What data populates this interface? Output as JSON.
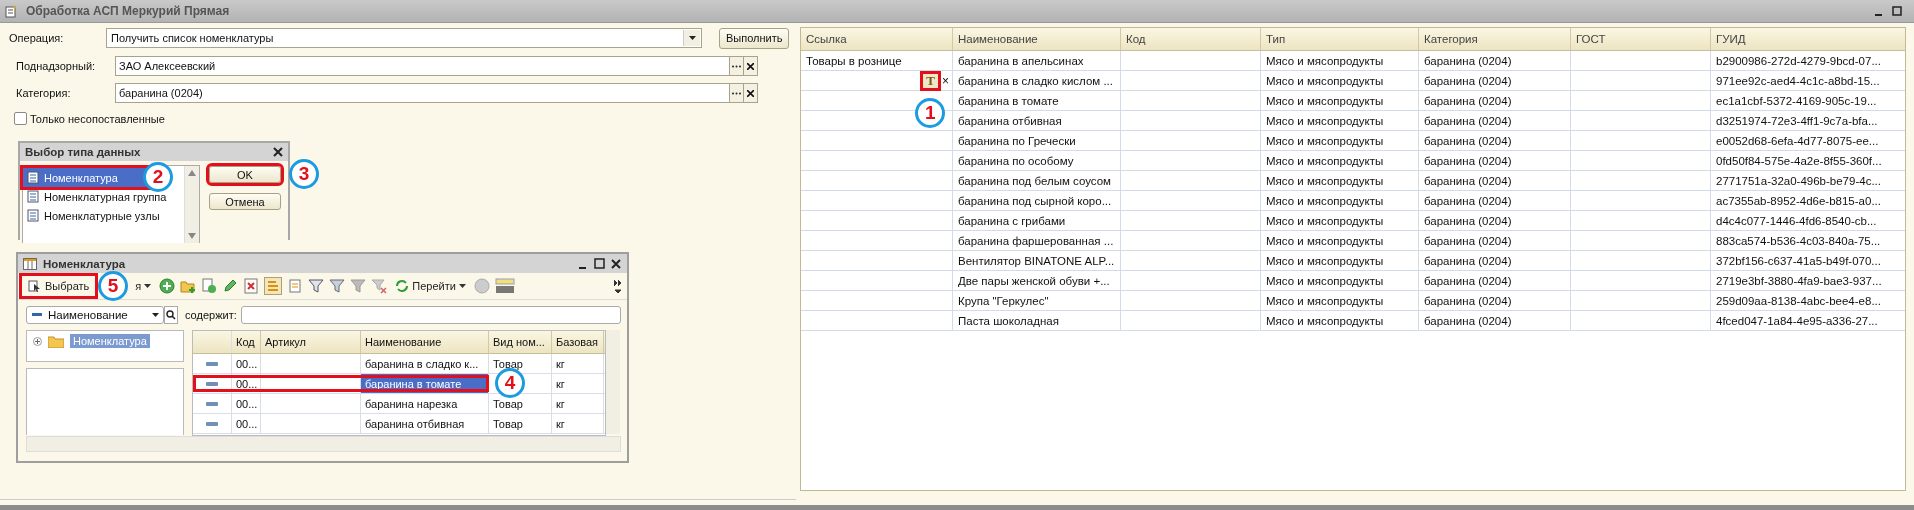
{
  "window": {
    "title": "Обработка  АСП Меркурий Прямая"
  },
  "operation": {
    "label": "Операция:",
    "value": "Получить список номенклатуры"
  },
  "run_button": "Выполнить",
  "fields": [
    {
      "label": "Поднадзорный:",
      "value": "ЗАО  Алексеевский"
    },
    {
      "label": "Категория:",
      "value": "баранина (0204)"
    }
  ],
  "only_unmatched": {
    "label": "Только несопоставленные",
    "checked": false
  },
  "type_dialog": {
    "title": "Выбор типа данных",
    "items": [
      {
        "label": "Номенклатура",
        "selected": true,
        "callout": "2"
      },
      {
        "label": "Номенклатурная группа",
        "selected": false
      },
      {
        "label": "Номенклатурные узлы",
        "selected": false
      }
    ],
    "buttons": [
      {
        "label": "OK",
        "callout": "3"
      },
      {
        "label": "Отмена"
      }
    ]
  },
  "catalog_window": {
    "title": "Номенклатура",
    "select_button": {
      "label": "Выбрать",
      "callout": "5"
    },
    "actions_menu": "я",
    "go_menu": "Перейти",
    "search_field": "Наименование",
    "search_condition": "содержит:",
    "tree": [
      {
        "label": "Номенклатура",
        "selected": true
      }
    ],
    "columns": [
      "Код",
      "Артикул",
      "Наименование",
      "Вид ном...",
      "Базовая"
    ],
    "rows": [
      {
        "cells": [
          "00...",
          "",
          "баранина в сладко к...",
          "Товар",
          "кг"
        ],
        "selected": false
      },
      {
        "cells": [
          "00...",
          "",
          "баранина в томате",
          "",
          "кг"
        ],
        "selected": true,
        "callout": "4"
      },
      {
        "cells": [
          "00...",
          "",
          "баранина нарезка",
          "Товар",
          "кг"
        ],
        "selected": false
      },
      {
        "cells": [
          "00...",
          "",
          "баранина отбивная",
          "Товар",
          "кг"
        ],
        "selected": false
      }
    ]
  },
  "result_table": {
    "columns": [
      "Ссылка",
      "Наименование",
      "Код",
      "Тип",
      "Категория",
      "ГОСТ",
      "ГУИД"
    ],
    "rows": [
      {
        "cells": [
          "Товары в рознице",
          "баранина  в апельсинах",
          "",
          "Мясо и мясопродукты",
          "баранина (0204)",
          "",
          "b2900986-272d-4279-9bcd-07..."
        ]
      },
      {
        "cells": [
          "",
          "баранина в сладко кислом ...",
          "",
          "Мясо и мясопродукты",
          "баранина (0204)",
          "",
          "971ee92c-aed4-4c1c-a8bd-15..."
        ],
        "editor": {
          "buttons": [
            "T",
            "×"
          ],
          "callout": "1"
        }
      },
      {
        "cells": [
          "",
          "баранина в томате",
          "",
          "Мясо и мясопродукты",
          "баранина (0204)",
          "",
          "ec1a1cbf-5372-4169-905c-19..."
        ]
      },
      {
        "cells": [
          "",
          "баранина отбивная",
          "",
          "Мясо и мясопродукты",
          "баранина (0204)",
          "",
          "d3251974-72e3-4ff1-9c7a-bfa..."
        ]
      },
      {
        "cells": [
          "",
          "баранина по Гречески",
          "",
          "Мясо и мясопродукты",
          "баранина (0204)",
          "",
          "e0052d68-6efa-4d77-8075-ee..."
        ]
      },
      {
        "cells": [
          "",
          "баранина по особому",
          "",
          "Мясо и мясопродукты",
          "баранина (0204)",
          "",
          "0fd50f84-575e-4a2e-8f55-360f..."
        ]
      },
      {
        "cells": [
          "",
          "баранина под белым соусом",
          "",
          "Мясо и мясопродукты",
          "баранина (0204)",
          "",
          "2771751a-32a0-496b-be79-4c..."
        ]
      },
      {
        "cells": [
          "",
          "баранина под сырной коро...",
          "",
          "Мясо и мясопродукты",
          "баранина (0204)",
          "",
          "ac7355ab-8952-4d6e-b815-a0..."
        ]
      },
      {
        "cells": [
          "",
          "баранина с грибами",
          "",
          "Мясо и мясопродукты",
          "баранина (0204)",
          "",
          "d4c4c077-1446-4fd6-8540-cb..."
        ]
      },
      {
        "cells": [
          "",
          "баранина фаршерованная ...",
          "",
          "Мясо и мясопродукты",
          "баранина (0204)",
          "",
          "883ca574-b536-4c03-840a-75..."
        ]
      },
      {
        "cells": [
          "",
          "Вентилятор BINATONE ALP...",
          "",
          "Мясо и мясопродукты",
          "баранина (0204)",
          "",
          "372bf156-c637-41a5-b49f-070..."
        ]
      },
      {
        "cells": [
          "",
          "Две пары женской обуви +...",
          "",
          "Мясо и мясопродукты",
          "баранина (0204)",
          "",
          "2719e3bf-3880-4fa9-bae3-937..."
        ]
      },
      {
        "cells": [
          "",
          "Крупа \"Геркулес\"",
          "",
          "Мясо и мясопродукты",
          "баранина (0204)",
          "",
          "259d09aa-8138-4abc-bee4-e8..."
        ]
      },
      {
        "cells": [
          "",
          "Паста шоколадная",
          "",
          "Мясо и мясопродукты",
          "баранина (0204)",
          "",
          "4fced047-1a84-4e95-a336-27..."
        ]
      }
    ]
  }
}
